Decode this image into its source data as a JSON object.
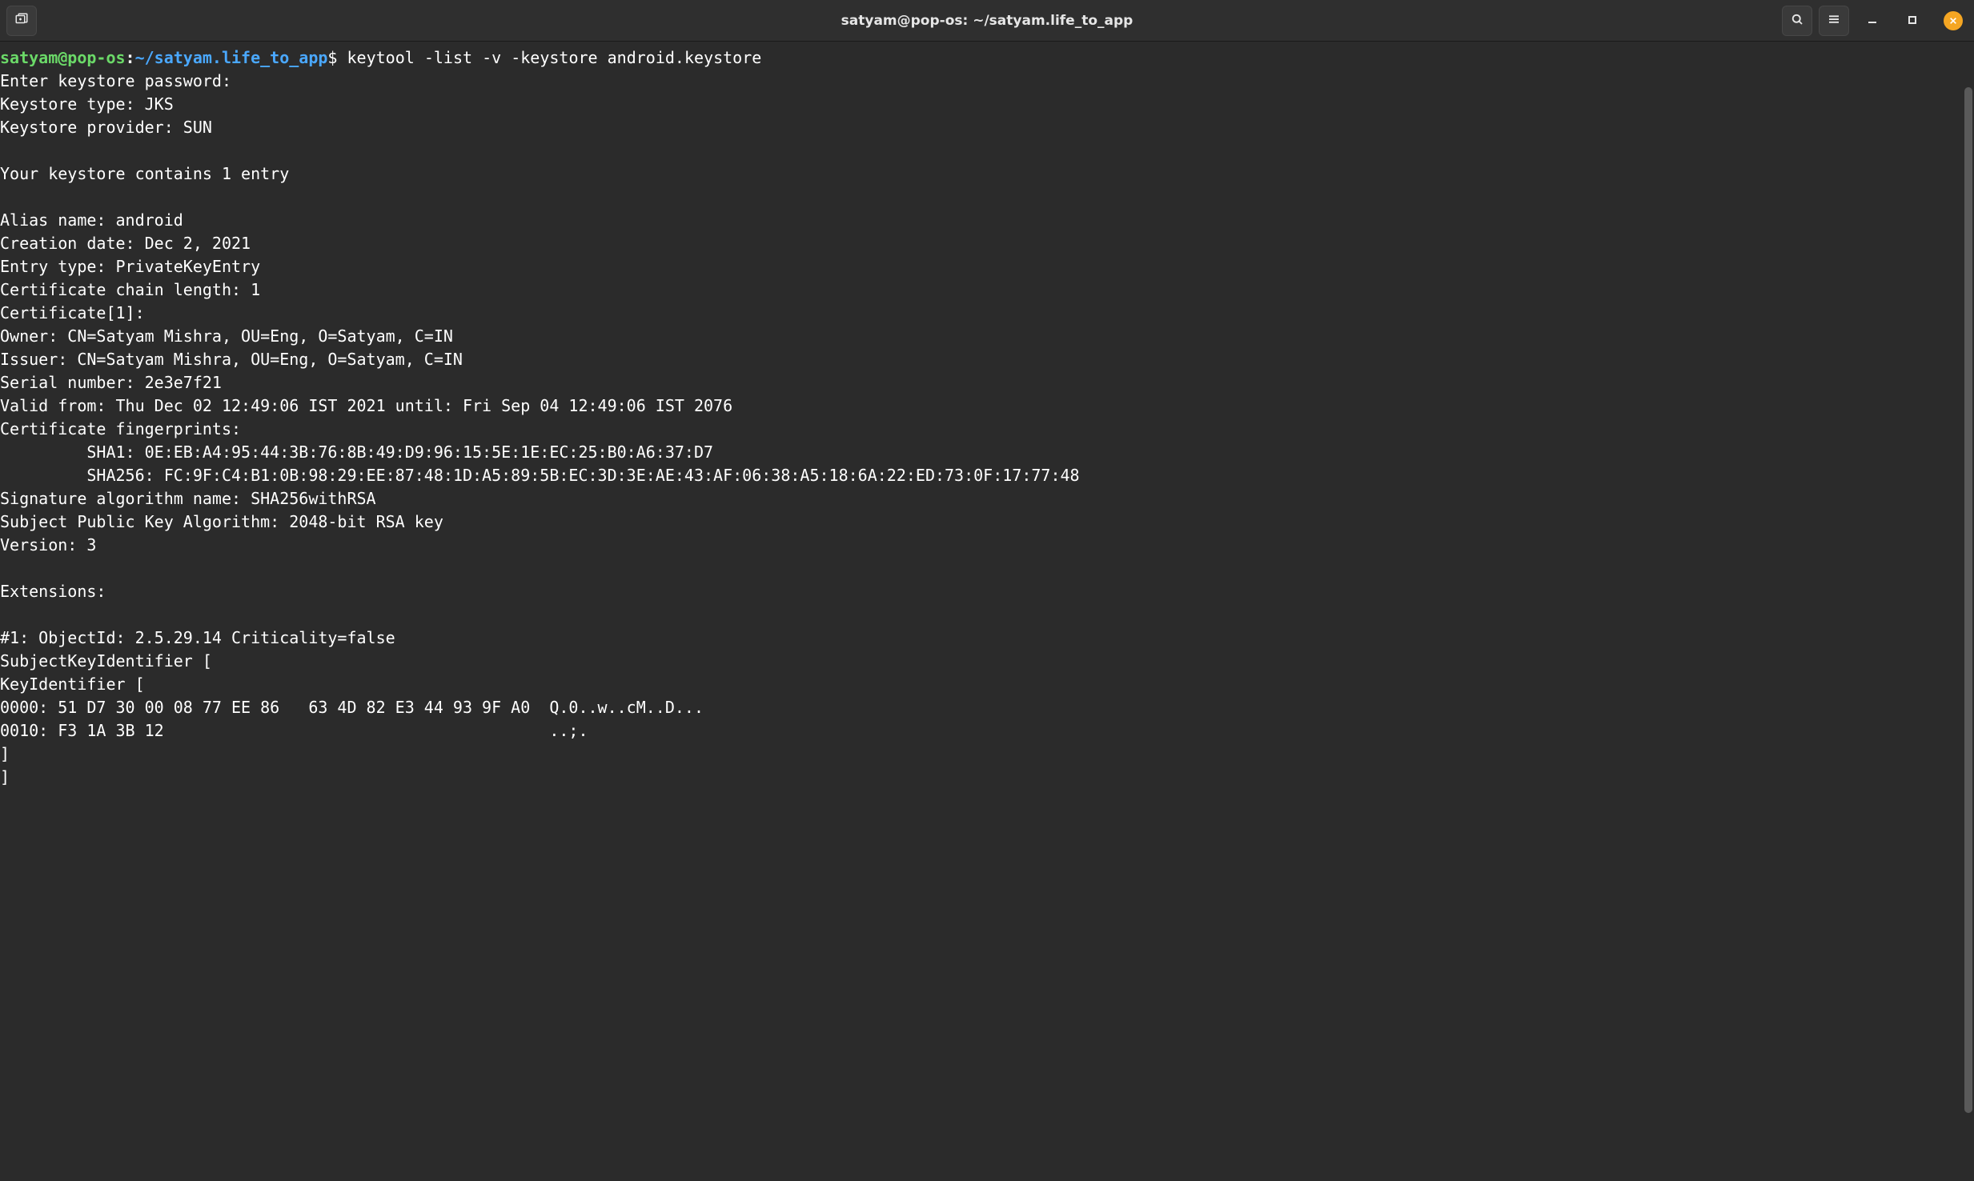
{
  "window": {
    "title": "satyam@pop-os: ~/satyam.life_to_app"
  },
  "titlebar": {
    "new_tab_icon": "new-tab-icon",
    "search_icon": "search-icon",
    "menu_icon": "hamburger-menu-icon",
    "minimize_icon": "minimize-icon",
    "maximize_icon": "maximize-icon",
    "close_icon": "close-icon"
  },
  "terminal": {
    "prompt": {
      "user_host": "satyam@pop-os",
      "separator": ":",
      "path": "~/satyam.life_to_app",
      "sign": "$ "
    },
    "command": "keytool -list -v -keystore android.keystore",
    "output_lines": [
      "Enter keystore password:",
      "Keystore type: JKS",
      "Keystore provider: SUN",
      "",
      "Your keystore contains 1 entry",
      "",
      "Alias name: android",
      "Creation date: Dec 2, 2021",
      "Entry type: PrivateKeyEntry",
      "Certificate chain length: 1",
      "Certificate[1]:",
      "Owner: CN=Satyam Mishra, OU=Eng, O=Satyam, C=IN",
      "Issuer: CN=Satyam Mishra, OU=Eng, O=Satyam, C=IN",
      "Serial number: 2e3e7f21",
      "Valid from: Thu Dec 02 12:49:06 IST 2021 until: Fri Sep 04 12:49:06 IST 2076",
      "Certificate fingerprints:",
      "         SHA1: 0E:EB:A4:95:44:3B:76:8B:49:D9:96:15:5E:1E:EC:25:B0:A6:37:D7",
      "         SHA256: FC:9F:C4:B1:0B:98:29:EE:87:48:1D:A5:89:5B:EC:3D:3E:AE:43:AF:06:38:A5:18:6A:22:ED:73:0F:17:77:48",
      "Signature algorithm name: SHA256withRSA",
      "Subject Public Key Algorithm: 2048-bit RSA key",
      "Version: 3",
      "",
      "Extensions:",
      "",
      "#1: ObjectId: 2.5.29.14 Criticality=false",
      "SubjectKeyIdentifier [",
      "KeyIdentifier [",
      "0000: 51 D7 30 00 08 77 EE 86   63 4D 82 E3 44 93 9F A0  Q.0..w..cM..D...",
      "0010: F3 1A 3B 12                                        ..;.",
      "]",
      "]"
    ]
  },
  "scrollbar": {
    "thumb_top_pct": 4,
    "thumb_height_pct": 90
  }
}
